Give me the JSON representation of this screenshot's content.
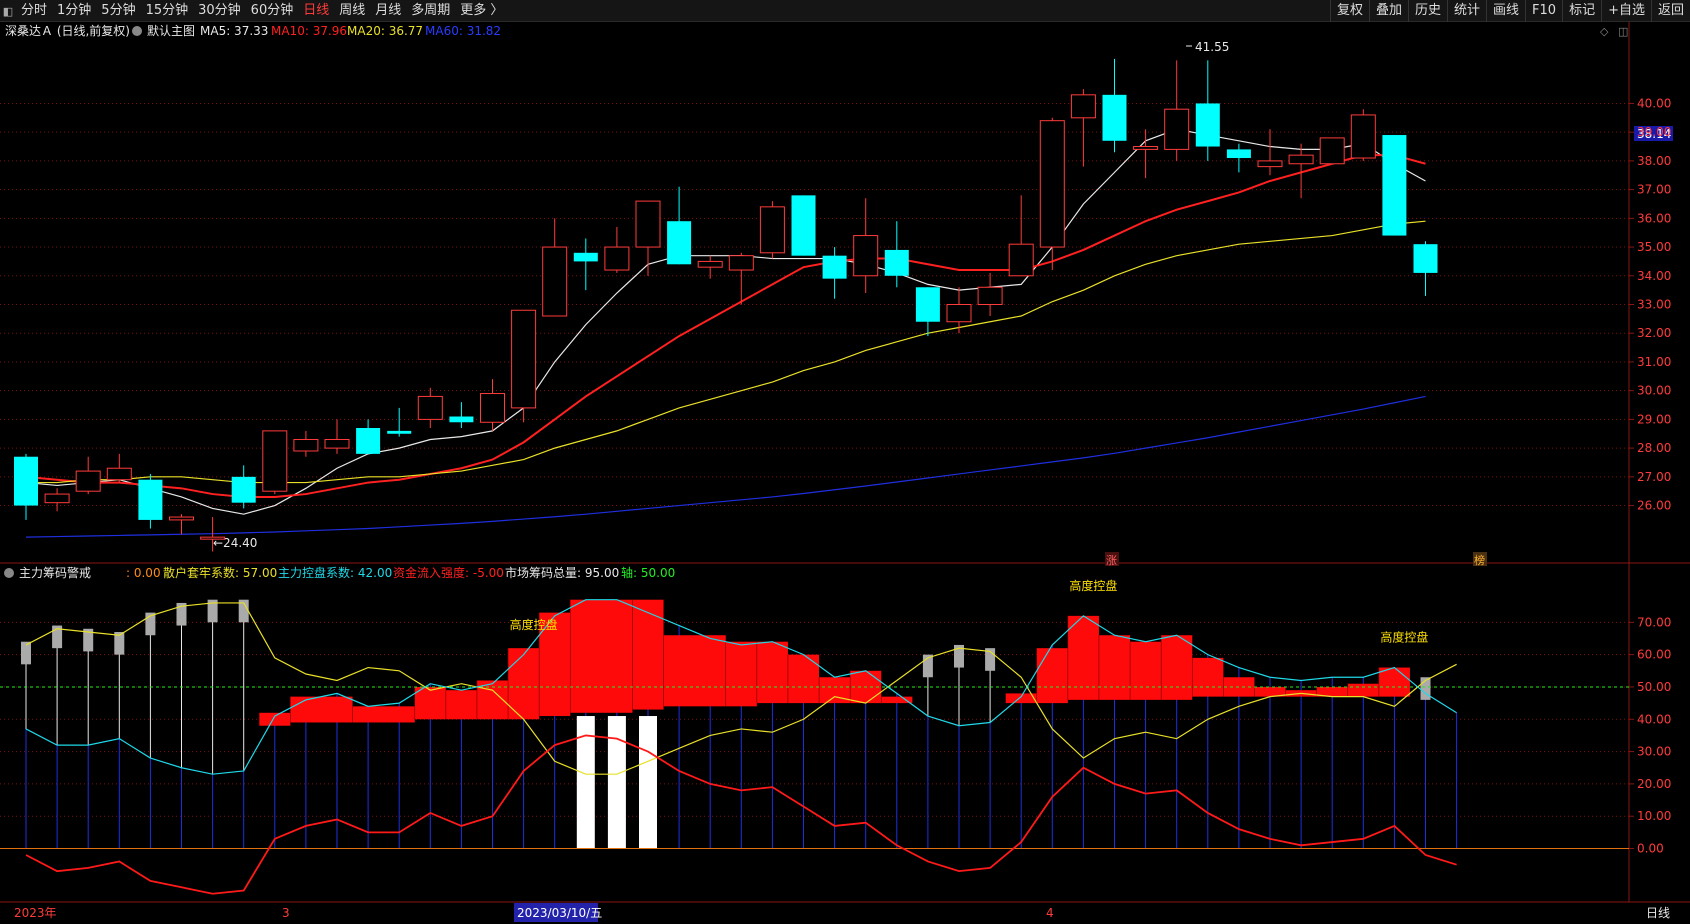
{
  "toolbar": {
    "left_items": [
      "分时",
      "1分钟",
      "5分钟",
      "15分钟",
      "30分钟",
      "60分钟",
      "日线",
      "周线",
      "月线",
      "多周期",
      "更多 〉"
    ],
    "active_index": 6,
    "right_items": [
      "复权",
      "叠加",
      "历史",
      "统计",
      "画线",
      "F10",
      "标记",
      "+自选",
      "返回"
    ]
  },
  "main_chart": {
    "stock": "深桑达Ａ (日线,前复权)",
    "template": "默认主图",
    "ma5_label": "MA5: 37.33",
    "ma10_label": "MA10: 37.96",
    "ma20_label": "MA20: 36.77",
    "ma60_label": "MA60: 31.82",
    "current_price_tag": "38.14",
    "high_marker": "41.55",
    "low_marker": "←24.40",
    "badge_zhang": "涨",
    "badge_bang": "榜",
    "colors": {
      "up": "#ff3b3b",
      "down": "#00ffff",
      "ma5": "#e8e8e8",
      "ma10": "#ff2020",
      "ma20": "#e8e028",
      "ma60": "#1f2fe0",
      "grid": "#7a1010"
    }
  },
  "indicator": {
    "name": "主力筹码警戒",
    "param0": ": 0.00",
    "trap_label": "散户套牢系数: 57.00",
    "control_label": "主力控盘系数: 42.00",
    "flow_label": "资金流入强度: -5.00",
    "total_label": "市场筹码总量: 95.00",
    "axis_label": "轴: 50.00",
    "annotation": "高度控盘"
  },
  "x_axis": {
    "year_label": "2023年",
    "month3": "3",
    "cursor_date": "2023/03/10/五",
    "month4": "4",
    "period_label": "日线"
  },
  "chart_data": [
    {
      "type": "candlestick",
      "title": "深桑达Ａ (日线,前复权)",
      "y_ticks": [
        26,
        27,
        28,
        29,
        30,
        31,
        32,
        33,
        34,
        35,
        36,
        37,
        38,
        39,
        40
      ],
      "y_tick_labels": [
        "26.00",
        "27.00",
        "28.00",
        "29.00",
        "30.00",
        "31.00",
        "32.00",
        "33.00",
        "34.00",
        "35.00",
        "36.00",
        "37.00",
        "38.00",
        "39.00",
        "40.00"
      ],
      "ylim": [
        24.0,
        42.0
      ],
      "candles": [
        {
          "o": 27.7,
          "h": 27.8,
          "l": 25.5,
          "c": 26.0
        },
        {
          "o": 26.1,
          "h": 26.6,
          "l": 25.8,
          "c": 26.4
        },
        {
          "o": 26.5,
          "h": 27.7,
          "l": 26.4,
          "c": 27.2
        },
        {
          "o": 26.9,
          "h": 27.8,
          "l": 26.8,
          "c": 27.3
        },
        {
          "o": 26.9,
          "h": 27.1,
          "l": 25.2,
          "c": 25.5
        },
        {
          "o": 25.5,
          "h": 25.7,
          "l": 25.0,
          "c": 25.6
        },
        {
          "o": 24.9,
          "h": 25.6,
          "l": 24.4,
          "c": 24.9
        },
        {
          "o": 27.0,
          "h": 27.4,
          "l": 25.9,
          "c": 26.1
        },
        {
          "o": 26.5,
          "h": 28.6,
          "l": 26.4,
          "c": 28.6
        },
        {
          "o": 27.9,
          "h": 28.6,
          "l": 27.7,
          "c": 28.3
        },
        {
          "o": 28.0,
          "h": 29.0,
          "l": 27.8,
          "c": 28.3
        },
        {
          "o": 28.7,
          "h": 29.0,
          "l": 27.8,
          "c": 27.8
        },
        {
          "o": 28.6,
          "h": 29.4,
          "l": 28.4,
          "c": 28.5
        },
        {
          "o": 29.0,
          "h": 30.1,
          "l": 28.7,
          "c": 29.8
        },
        {
          "o": 29.1,
          "h": 29.6,
          "l": 28.7,
          "c": 28.9
        },
        {
          "o": 28.9,
          "h": 30.4,
          "l": 28.6,
          "c": 29.9
        },
        {
          "o": 29.4,
          "h": 31.1,
          "l": 28.9,
          "c": 32.8
        },
        {
          "o": 32.6,
          "h": 36.0,
          "l": 32.6,
          "c": 35.0
        },
        {
          "o": 34.8,
          "h": 35.3,
          "l": 33.5,
          "c": 34.5
        },
        {
          "o": 34.2,
          "h": 35.7,
          "l": 34.1,
          "c": 35.0
        },
        {
          "o": 35.0,
          "h": 36.6,
          "l": 34.0,
          "c": 36.6
        },
        {
          "o": 35.9,
          "h": 37.1,
          "l": 34.4,
          "c": 34.4
        },
        {
          "o": 34.3,
          "h": 34.7,
          "l": 33.9,
          "c": 34.5
        },
        {
          "o": 34.2,
          "h": 34.8,
          "l": 33.0,
          "c": 34.7
        },
        {
          "o": 34.8,
          "h": 36.6,
          "l": 34.6,
          "c": 36.4
        },
        {
          "o": 36.8,
          "h": 36.8,
          "l": 34.7,
          "c": 34.7
        },
        {
          "o": 34.7,
          "h": 35.0,
          "l": 33.2,
          "c": 33.9
        },
        {
          "o": 34.0,
          "h": 36.7,
          "l": 33.4,
          "c": 35.4
        },
        {
          "o": 34.9,
          "h": 35.9,
          "l": 33.6,
          "c": 34.0
        },
        {
          "o": 33.6,
          "h": 33.6,
          "l": 31.9,
          "c": 32.4
        },
        {
          "o": 32.4,
          "h": 33.6,
          "l": 32.0,
          "c": 33.0
        },
        {
          "o": 33.0,
          "h": 34.1,
          "l": 32.6,
          "c": 33.6
        },
        {
          "o": 34.0,
          "h": 36.8,
          "l": 34.0,
          "c": 35.1
        },
        {
          "o": 35.0,
          "h": 39.5,
          "l": 34.2,
          "c": 39.4
        },
        {
          "o": 39.5,
          "h": 40.5,
          "l": 37.8,
          "c": 40.3
        },
        {
          "o": 40.3,
          "h": 41.55,
          "l": 38.3,
          "c": 38.7
        },
        {
          "o": 38.4,
          "h": 39.1,
          "l": 37.4,
          "c": 38.5
        },
        {
          "o": 38.4,
          "h": 41.5,
          "l": 38.0,
          "c": 39.8
        },
        {
          "o": 40.0,
          "h": 41.5,
          "l": 38.0,
          "c": 38.5
        },
        {
          "o": 38.4,
          "h": 38.6,
          "l": 37.6,
          "c": 38.1
        },
        {
          "o": 37.8,
          "h": 39.1,
          "l": 37.5,
          "c": 38.0
        },
        {
          "o": 37.9,
          "h": 38.6,
          "l": 36.7,
          "c": 38.2
        },
        {
          "o": 37.9,
          "h": 38.8,
          "l": 37.9,
          "c": 38.8
        },
        {
          "o": 38.1,
          "h": 39.8,
          "l": 38.0,
          "c": 39.6
        },
        {
          "o": 38.9,
          "h": 38.9,
          "l": 35.4,
          "c": 35.4
        },
        {
          "o": 35.1,
          "h": 35.2,
          "l": 33.3,
          "c": 34.1
        }
      ],
      "series": [
        {
          "name": "MA5",
          "values": [
            26.8,
            26.7,
            26.8,
            26.9,
            26.6,
            26.3,
            25.9,
            25.7,
            26.0,
            26.6,
            27.3,
            27.8,
            28.0,
            28.3,
            28.4,
            28.6,
            29.4,
            31.0,
            32.3,
            33.4,
            34.4,
            34.7,
            34.7,
            34.7,
            34.6,
            34.6,
            34.6,
            34.4,
            34.1,
            33.7,
            33.5,
            33.6,
            33.7,
            35.0,
            36.5,
            37.6,
            38.7,
            39.1,
            38.9,
            38.7,
            38.5,
            38.4,
            38.4,
            38.6,
            37.9,
            37.3
          ]
        },
        {
          "name": "MA10",
          "values": [
            27.0,
            26.9,
            26.8,
            26.8,
            26.7,
            26.6,
            26.4,
            26.3,
            26.3,
            26.4,
            26.6,
            26.8,
            26.9,
            27.1,
            27.3,
            27.6,
            28.2,
            29.0,
            29.8,
            30.5,
            31.2,
            31.9,
            32.5,
            33.1,
            33.7,
            34.3,
            34.5,
            34.6,
            34.6,
            34.4,
            34.2,
            34.2,
            34.2,
            34.5,
            34.9,
            35.4,
            35.9,
            36.3,
            36.6,
            36.9,
            37.3,
            37.6,
            37.9,
            38.2,
            38.2,
            37.9
          ]
        },
        {
          "name": "MA20",
          "values": [
            26.8,
            26.8,
            26.9,
            26.9,
            27.0,
            27.0,
            26.9,
            26.8,
            26.8,
            26.8,
            26.9,
            27.0,
            27.0,
            27.1,
            27.2,
            27.4,
            27.6,
            28.0,
            28.3,
            28.6,
            29.0,
            29.4,
            29.7,
            30.0,
            30.3,
            30.7,
            31.0,
            31.4,
            31.7,
            32.0,
            32.2,
            32.4,
            32.6,
            33.1,
            33.5,
            34.0,
            34.4,
            34.7,
            34.9,
            35.1,
            35.2,
            35.3,
            35.4,
            35.6,
            35.8,
            35.9
          ]
        },
        {
          "name": "MA60",
          "values": [
            24.9,
            24.92,
            24.94,
            24.96,
            24.98,
            25.0,
            25.02,
            25.05,
            25.08,
            25.12,
            25.16,
            25.2,
            25.26,
            25.32,
            25.38,
            25.45,
            25.53,
            25.61,
            25.7,
            25.8,
            25.9,
            26.0,
            26.1,
            26.2,
            26.3,
            26.42,
            26.55,
            26.68,
            26.82,
            26.96,
            27.1,
            27.24,
            27.38,
            27.52,
            27.66,
            27.82,
            28.0,
            28.18,
            28.36,
            28.56,
            28.76,
            28.96,
            29.16,
            29.36,
            29.58,
            29.8
          ]
        }
      ]
    },
    {
      "type": "bar",
      "title": "主力筹码警戒",
      "y_ticks": [
        0,
        10,
        20,
        30,
        40,
        50,
        60,
        70
      ],
      "y_tick_labels": [
        "0.00",
        "10.00",
        "20.00",
        "30.00",
        "40.00",
        "50.00",
        "60.00",
        "70.00"
      ],
      "ylim": [
        -15,
        80
      ],
      "series": [
        {
          "name": "散户套牢系数",
          "values": [
            63,
            68,
            67,
            66,
            72,
            75,
            76,
            76,
            59,
            54,
            52,
            56,
            55,
            49,
            51,
            49,
            40,
            27,
            23,
            23,
            27,
            31,
            35,
            37,
            36,
            40,
            47,
            45,
            52,
            59,
            62,
            61,
            53,
            37,
            28,
            34,
            36,
            34,
            40,
            44,
            47,
            48,
            47,
            47,
            44,
            52,
            57
          ]
        },
        {
          "name": "主力控盘系数",
          "values": [
            37,
            32,
            32,
            34,
            28,
            25,
            23,
            24,
            41,
            46,
            48,
            44,
            45,
            51,
            49,
            51,
            60,
            72,
            77,
            77,
            73,
            69,
            65,
            63,
            64,
            60,
            53,
            55,
            48,
            41,
            38,
            39,
            47,
            63,
            72,
            66,
            64,
            66,
            60,
            56,
            53,
            52,
            53,
            53,
            56,
            48,
            42
          ]
        },
        {
          "name": "资金流入强度",
          "values": [
            -2,
            -7,
            -6,
            -4,
            -10,
            -12,
            -14,
            -13,
            3,
            7,
            9,
            5,
            5,
            11,
            7,
            10,
            24,
            32,
            35,
            34,
            30,
            24,
            20,
            18,
            19,
            13,
            7,
            8,
            1,
            -4,
            -7,
            -6,
            2,
            16,
            25,
            20,
            17,
            18,
            11,
            6,
            3,
            1,
            2,
            3,
            7,
            -2,
            -5
          ]
        },
        {
          "name": "市场筹码总量",
          "values": [
            45,
            45,
            45,
            45,
            45,
            45,
            45,
            45,
            45,
            45,
            45,
            45,
            45,
            45,
            45,
            45,
            45,
            45,
            45,
            45,
            45,
            45,
            45,
            45,
            45,
            45,
            45,
            45,
            45,
            45,
            45,
            45,
            45,
            45,
            45,
            45,
            45,
            45,
            45,
            45,
            45,
            45,
            45,
            45,
            45,
            45,
            45
          ]
        }
      ],
      "red_blocks": [
        {
          "from": 8,
          "to": 8,
          "top": 42,
          "bottom": 38
        },
        {
          "from": 9,
          "to": 10,
          "top": 47,
          "bottom": 39
        },
        {
          "from": 11,
          "to": 12,
          "top": 44,
          "bottom": 39
        },
        {
          "from": 13,
          "to": 13,
          "top": 50,
          "bottom": 40
        },
        {
          "from": 14,
          "to": 14,
          "top": 49,
          "bottom": 40
        },
        {
          "from": 15,
          "to": 15,
          "top": 52,
          "bottom": 40
        },
        {
          "from": 16,
          "to": 16,
          "top": 62,
          "bottom": 40
        },
        {
          "from": 17,
          "to": 17,
          "top": 73,
          "bottom": 41
        },
        {
          "from": 18,
          "to": 19,
          "top": 77,
          "bottom": 42
        },
        {
          "from": 20,
          "to": 20,
          "top": 77,
          "bottom": 43
        },
        {
          "from": 21,
          "to": 22,
          "top": 66,
          "bottom": 44
        },
        {
          "from": 23,
          "to": 23,
          "top": 64,
          "bottom": 44
        },
        {
          "from": 24,
          "to": 24,
          "top": 64,
          "bottom": 45
        },
        {
          "from": 25,
          "to": 25,
          "top": 60,
          "bottom": 45
        },
        {
          "from": 26,
          "to": 26,
          "top": 53,
          "bottom": 45
        },
        {
          "from": 27,
          "to": 27,
          "top": 55,
          "bottom": 45
        },
        {
          "from": 28,
          "to": 28,
          "top": 47,
          "bottom": 45
        },
        {
          "from": 32,
          "to": 32,
          "top": 48,
          "bottom": 45
        },
        {
          "from": 33,
          "to": 33,
          "top": 62,
          "bottom": 45
        },
        {
          "from": 34,
          "to": 34,
          "top": 72,
          "bottom": 46
        },
        {
          "from": 35,
          "to": 35,
          "top": 66,
          "bottom": 46
        },
        {
          "from": 36,
          "to": 36,
          "top": 64,
          "bottom": 46
        },
        {
          "from": 37,
          "to": 37,
          "top": 66,
          "bottom": 46
        },
        {
          "from": 38,
          "to": 38,
          "top": 59,
          "bottom": 47
        },
        {
          "from": 39,
          "to": 39,
          "top": 53,
          "bottom": 47
        },
        {
          "from": 40,
          "to": 40,
          "top": 50,
          "bottom": 47
        },
        {
          "from": 41,
          "to": 41,
          "top": 49,
          "bottom": 47
        },
        {
          "from": 42,
          "to": 42,
          "top": 50,
          "bottom": 47
        },
        {
          "from": 43,
          "to": 43,
          "top": 51,
          "bottom": 47
        },
        {
          "from": 44,
          "to": 44,
          "top": 56,
          "bottom": 47
        }
      ],
      "gray_bars": [
        0,
        1,
        2,
        3,
        4,
        5,
        6,
        7,
        29,
        30,
        31,
        45
      ],
      "white_bars": [
        18,
        19,
        20
      ],
      "annotations_at": [
        16,
        34,
        44
      ]
    }
  ]
}
